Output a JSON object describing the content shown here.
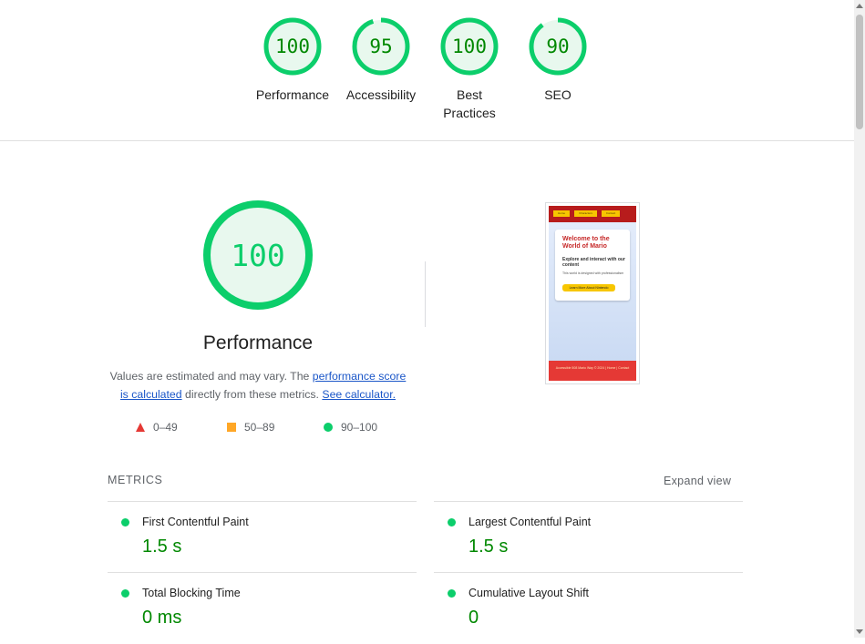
{
  "colors": {
    "pass_green": "#0cce6b",
    "pass_text": "#008800",
    "fail_red": "#e53935",
    "average_orange": "#ffa726",
    "link_blue": "#1a56c8"
  },
  "gauges": [
    {
      "score": "100",
      "value": 100,
      "label": "Performance"
    },
    {
      "score": "95",
      "value": 95,
      "label": "Accessibility"
    },
    {
      "score": "100",
      "value": 100,
      "label": "Best\nPractices"
    },
    {
      "score": "90",
      "value": 90,
      "label": "SEO"
    }
  ],
  "performance": {
    "score": "100",
    "value": 100,
    "title": "Performance",
    "desc_prefix": "Values are estimated and may vary. The ",
    "link_score": "performance score is calculated",
    "desc_middle": " directly from these metrics.",
    "link_calculator": "See calculator."
  },
  "legend": [
    {
      "range": "0–49",
      "shape": "triangle"
    },
    {
      "range": "50–89",
      "shape": "square"
    },
    {
      "range": "90–100",
      "shape": "circle"
    }
  ],
  "thumbnail": {
    "nav": [
      "Home",
      "Characters",
      "Contact"
    ],
    "heading": "Welcome to the World of Mario",
    "subheading": "Explore and interact with our content",
    "paragraph": "This world is designed with professionalism",
    "button": "Learn More About Nintendo",
    "footer": "Accessible 508 Mario Way © 2024 | Home | Contact"
  },
  "metrics": {
    "heading": "METRICS",
    "expand_label": "Expand view",
    "items": [
      {
        "label": "First Contentful Paint",
        "value": "1.5 s"
      },
      {
        "label": "Largest Contentful Paint",
        "value": "1.5 s"
      },
      {
        "label": "Total Blocking Time",
        "value": "0 ms"
      },
      {
        "label": "Cumulative Layout Shift",
        "value": "0"
      }
    ]
  }
}
